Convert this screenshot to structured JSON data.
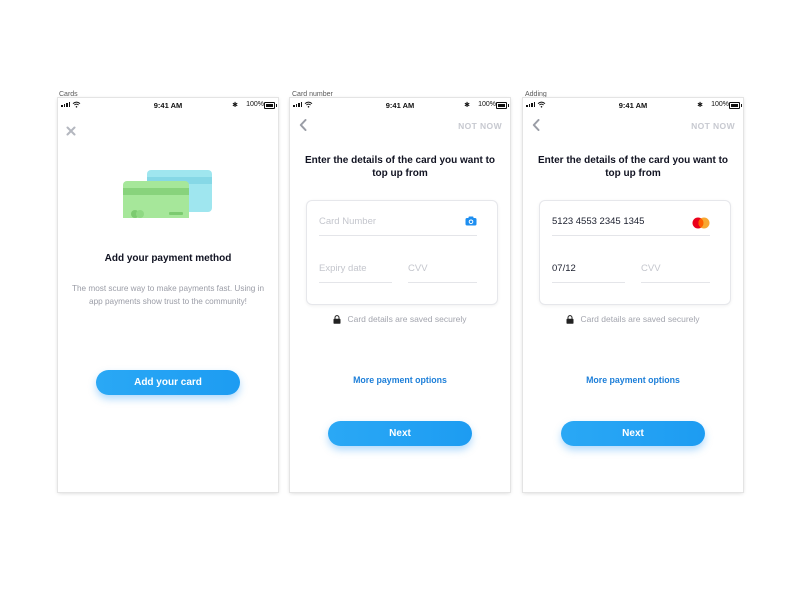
{
  "screens": [
    {
      "frame_label": "Cards",
      "status": {
        "time": "9:41 AM",
        "battery": "100%"
      },
      "title": "Add your payment method",
      "body": "The most scure way to make payments fast. Using in app payments show trust to the community!",
      "button_label": "Add your card"
    },
    {
      "frame_label": "Card number",
      "status": {
        "time": "9:41 AM",
        "battery": "100%"
      },
      "not_now": "NOT NOW",
      "title": "Enter the details of the card you want to top up from",
      "card_number_placeholder": "Card Number",
      "expiry_placeholder": "Expiry date",
      "cvv_placeholder": "CVV",
      "secure_text": "Card details are saved securely",
      "more_options": "More payment options",
      "button_label": "Next"
    },
    {
      "frame_label": "Adding",
      "status": {
        "time": "9:41 AM",
        "battery": "100%"
      },
      "not_now": "NOT NOW",
      "title": "Enter the details of the card you want to top up from",
      "card_number_value": "5123 4553 2345 1345",
      "expiry_value": "07/12",
      "cvv_placeholder": "CVV",
      "secure_text": "Card details are saved securely",
      "more_options": "More payment options",
      "button_label": "Next"
    }
  ],
  "colors": {
    "accent": "#1d9cf2",
    "link": "#1d7fd9",
    "card_green": "#a6e79a",
    "card_teal": "#9fe6ef",
    "mastercard_red": "#eb001b",
    "mastercard_orange": "#f79e1b"
  },
  "icons": [
    "close-icon",
    "back-chevron-icon",
    "camera-icon",
    "mastercard-icon",
    "lock-icon",
    "credit-cards-illustration"
  ]
}
